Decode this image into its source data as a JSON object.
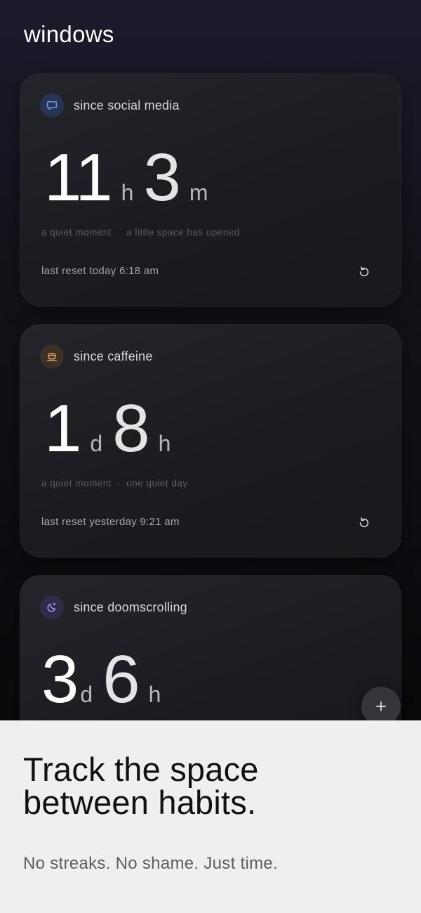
{
  "app": {
    "title": "windows"
  },
  "cards": [
    {
      "label": "since social media",
      "icon": "chat-bubble-icon",
      "first_value": "11",
      "first_unit": "h",
      "second_value": "3",
      "second_unit": "m",
      "meta_left": "a quiet moment",
      "meta_separator": "·",
      "meta_right": "a little space has opened",
      "last_reset": "last reset today 6:18 am",
      "accent": "#4f7be0"
    },
    {
      "label": "since caffeine",
      "icon": "coffee-cup-icon",
      "first_value": "1",
      "first_unit": "d",
      "second_value": "8",
      "second_unit": "h",
      "meta_left": "a quiet moment",
      "meta_separator": "·",
      "meta_right": "one quiet day",
      "last_reset": "last reset yesterday 9:21 am",
      "accent": "#d8a06a"
    },
    {
      "label": "since doomscrolling",
      "icon": "moon-stars-icon",
      "first_value": "3",
      "first_unit": "d",
      "second_value": "6",
      "second_unit": "h",
      "accent": "#9a8cf0"
    }
  ],
  "fab": {
    "icon": "plus-icon"
  },
  "promo": {
    "headline_line1": "Track the space",
    "headline_line2": "between habits.",
    "subline": "No streaks. No shame. Just time."
  }
}
